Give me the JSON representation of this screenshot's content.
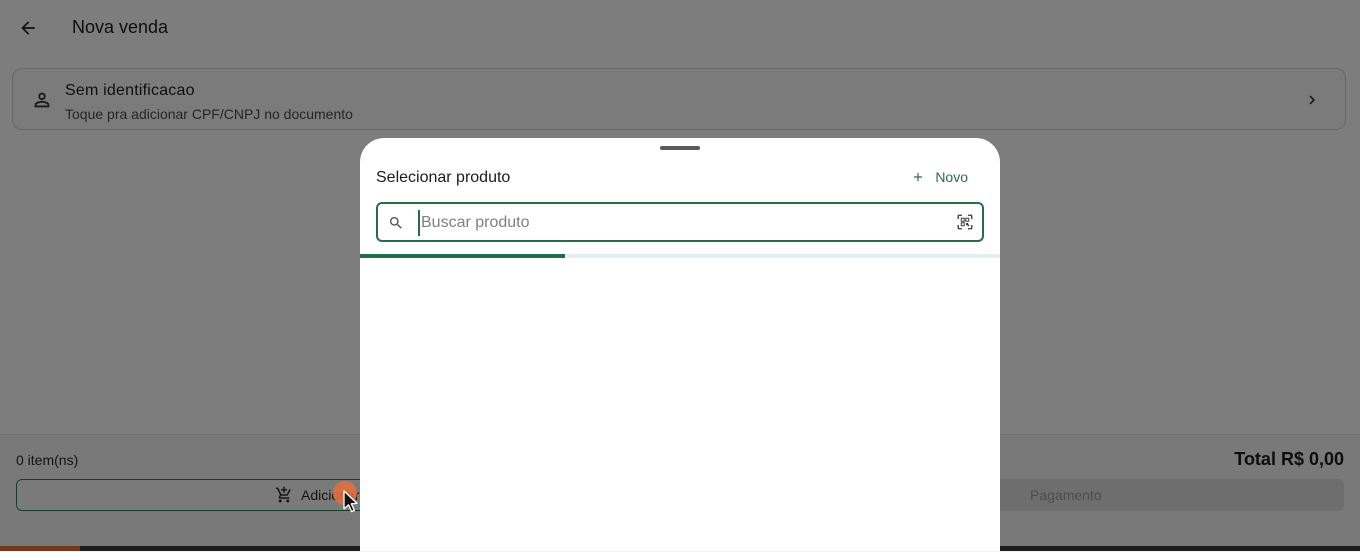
{
  "header": {
    "title": "Nova venda",
    "back_icon": "arrow-back-icon"
  },
  "customer": {
    "title": "Sem identificacao",
    "subtitle": "Toque pra adicionar CPF/CNPJ no documento",
    "icon": "person-icon"
  },
  "footer": {
    "item_count": "0 item(ns)",
    "total": "Total R$ 0,00",
    "add_label": "Adicionar",
    "pay_label": "Pagamento"
  },
  "sheet": {
    "title": "Selecionar produto",
    "new_label": "Novo",
    "search": {
      "placeholder": "Buscar produto",
      "value": ""
    },
    "loading_progress": 0.32
  },
  "colors": {
    "accent": "#2b6b4c",
    "progress": "#1f6e4a",
    "cursor": "#e0703a"
  }
}
